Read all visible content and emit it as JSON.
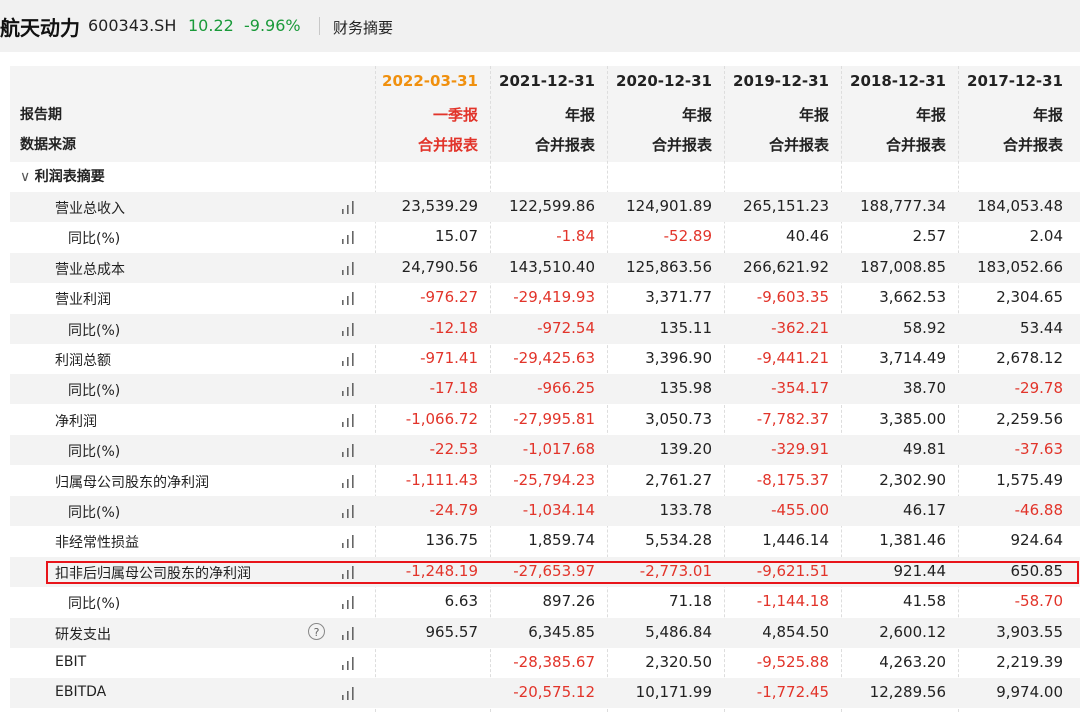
{
  "header": {
    "name": "航天动力",
    "code": "600343.SH",
    "price": "10.22",
    "change": "-9.96%",
    "section": "财务摘要",
    "price_color": "#1a9a3a"
  },
  "table": {
    "row_label_period": "报告期",
    "row_label_source": "数据来源",
    "section_title": "利润表摘要",
    "columns": [
      {
        "date": "2022-03-31",
        "period": "一季报",
        "source": "合并报表"
      },
      {
        "date": "2021-12-31",
        "period": "年报",
        "source": "合并报表"
      },
      {
        "date": "2020-12-31",
        "period": "年报",
        "source": "合并报表"
      },
      {
        "date": "2019-12-31",
        "period": "年报",
        "source": "合并报表"
      },
      {
        "date": "2018-12-31",
        "period": "年报",
        "source": "合并报表"
      },
      {
        "date": "2017-12-31",
        "period": "年报",
        "source": "合并报表"
      }
    ],
    "rows": [
      {
        "label": "营业总收入",
        "values": [
          "23,539.29",
          "122,599.86",
          "124,901.89",
          "265,151.23",
          "188,777.34",
          "184,053.48"
        ]
      },
      {
        "label": "同比(%)",
        "values": [
          "15.07",
          "-1.84",
          "-52.89",
          "40.46",
          "2.57",
          "2.04"
        ]
      },
      {
        "label": "营业总成本",
        "values": [
          "24,790.56",
          "143,510.40",
          "125,863.56",
          "266,621.92",
          "187,008.85",
          "183,052.66"
        ]
      },
      {
        "label": "营业利润",
        "values": [
          "-976.27",
          "-29,419.93",
          "3,371.77",
          "-9,603.35",
          "3,662.53",
          "2,304.65"
        ]
      },
      {
        "label": "同比(%)",
        "values": [
          "-12.18",
          "-972.54",
          "135.11",
          "-362.21",
          "58.92",
          "53.44"
        ]
      },
      {
        "label": "利润总额",
        "values": [
          "-971.41",
          "-29,425.63",
          "3,396.90",
          "-9,441.21",
          "3,714.49",
          "2,678.12"
        ]
      },
      {
        "label": "同比(%)",
        "values": [
          "-17.18",
          "-966.25",
          "135.98",
          "-354.17",
          "38.70",
          "-29.78"
        ]
      },
      {
        "label": "净利润",
        "values": [
          "-1,066.72",
          "-27,995.81",
          "3,050.73",
          "-7,782.37",
          "3,385.00",
          "2,259.56"
        ]
      },
      {
        "label": "同比(%)",
        "values": [
          "-22.53",
          "-1,017.68",
          "139.20",
          "-329.91",
          "49.81",
          "-37.63"
        ]
      },
      {
        "label": "归属母公司股东的净利润",
        "values": [
          "-1,111.43",
          "-25,794.23",
          "2,761.27",
          "-8,175.37",
          "2,302.90",
          "1,575.49"
        ]
      },
      {
        "label": "同比(%)",
        "values": [
          "-24.79",
          "-1,034.14",
          "133.78",
          "-455.00",
          "46.17",
          "-46.88"
        ]
      },
      {
        "label": "非经常性损益",
        "values": [
          "136.75",
          "1,859.74",
          "5,534.28",
          "1,446.14",
          "1,381.46",
          "924.64"
        ]
      },
      {
        "label": "扣非后归属母公司股东的净利润",
        "values": [
          "-1,248.19",
          "-27,653.97",
          "-2,773.01",
          "-9,621.51",
          "921.44",
          "650.85"
        ]
      },
      {
        "label": "同比(%)",
        "values": [
          "6.63",
          "897.26",
          "71.18",
          "-1,144.18",
          "41.58",
          "-58.70"
        ]
      },
      {
        "label": "研发支出",
        "values": [
          "965.57",
          "6,345.85",
          "5,486.84",
          "4,854.50",
          "2,600.12",
          "3,903.55"
        ]
      },
      {
        "label": "EBIT",
        "values": [
          "",
          "-28,385.67",
          "2,320.50",
          "-9,525.88",
          "4,263.20",
          "2,219.39"
        ]
      },
      {
        "label": "EBITDA",
        "values": [
          "",
          "-20,575.12",
          "10,171.99",
          "-1,772.45",
          "12,289.56",
          "9,974.00"
        ]
      }
    ],
    "help_icon_text": "?",
    "colors": {
      "negative": "#e2342a",
      "highlight_date": "#f0900e",
      "highlight_box": "#e8141a"
    }
  }
}
